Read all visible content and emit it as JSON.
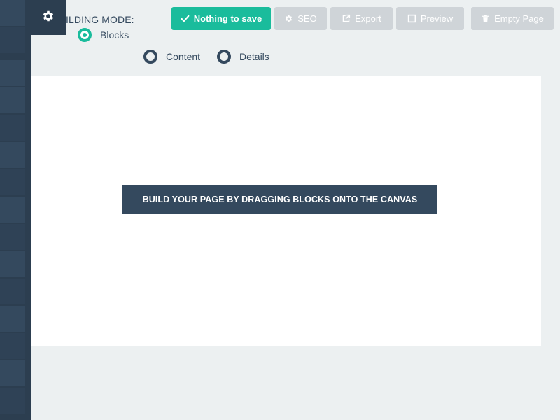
{
  "header": {
    "mode_label": "ILDING MODE:"
  },
  "modes": [
    {
      "label": "Blocks",
      "checked": true
    },
    {
      "label": "Content",
      "checked": false
    },
    {
      "label": "Details",
      "checked": false
    }
  ],
  "toolbar": {
    "save_label": "Nothing to save",
    "seo_label": "SEO",
    "export_label": "Export",
    "preview_label": "Preview",
    "empty_label": "Empty Page"
  },
  "canvas": {
    "message": "BUILD YOUR PAGE BY DRAGGING BLOCKS ONTO THE CANVAS"
  },
  "icons": {
    "settings": "gear-icon",
    "save": "check-icon",
    "seo": "gear-icon",
    "export": "external-link-icon",
    "preview": "square-icon",
    "empty": "trash-icon"
  },
  "colors": {
    "sidebar": "#2c3e50",
    "accent": "#1abc9c",
    "disabled_button": "#cfd4d8",
    "text_dark": "#34495e",
    "background": "#ecf0f1",
    "canvas": "#ffffff"
  }
}
